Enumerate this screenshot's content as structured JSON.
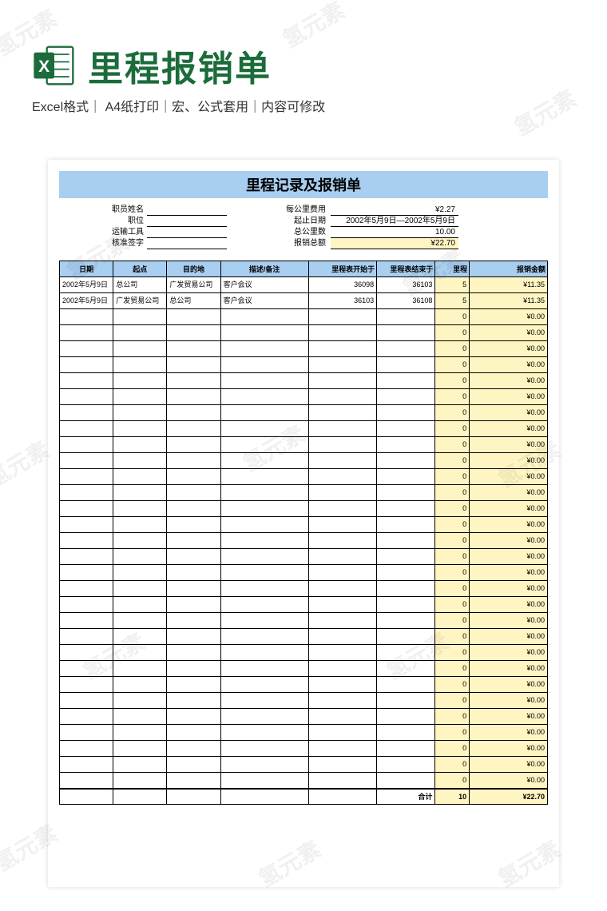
{
  "watermark_text": "氢元素",
  "header": {
    "title": "里程报销单",
    "subtitle": "Excel格式｜ A4纸打印｜宏、公式套用｜内容可修改"
  },
  "sheet": {
    "title": "里程记录及报销单",
    "info_left_labels": [
      "职员姓名",
      "职位",
      "运输工具",
      "核准签字"
    ],
    "info_right_labels": [
      "每公里费用",
      "起止日期",
      "总公里数",
      "报销总额"
    ],
    "info_right_values": [
      "¥2.27",
      "2002年5月9日—2002年5月9日",
      "10.00",
      "¥22.70"
    ],
    "columns": [
      "日期",
      "起点",
      "目的地",
      "描述/备注",
      "里程表开始于",
      "里程表结束于",
      "里程",
      "报销金额"
    ],
    "rows": [
      {
        "date": "2002年5月9日",
        "start": "总公司",
        "dest": "广发贸易公司",
        "note": "客户会议",
        "odo_s": "36098",
        "odo_e": "36103",
        "miles": "5",
        "amt": "¥11.35"
      },
      {
        "date": "2002年5月9日",
        "start": "广发贸易公司",
        "dest": "总公司",
        "note": "客户会议",
        "odo_s": "36103",
        "odo_e": "36108",
        "miles": "5",
        "amt": "¥11.35"
      }
    ],
    "empty_miles": "0",
    "empty_amt": "¥0.00",
    "empty_row_count": 30,
    "total_label": "合计",
    "total_miles": "10",
    "total_amt": "¥22.70"
  }
}
